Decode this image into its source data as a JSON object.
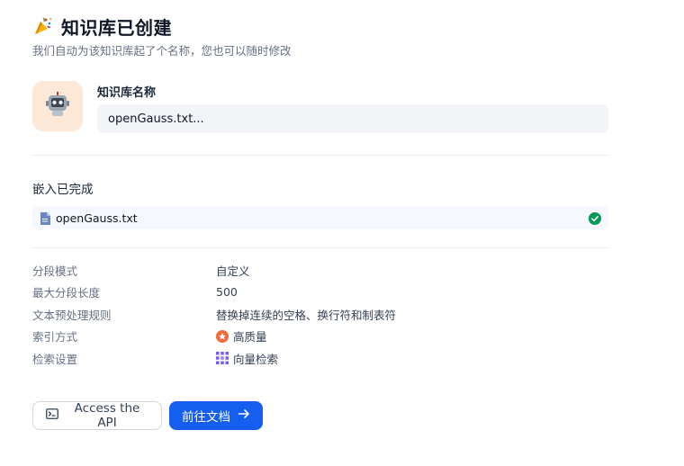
{
  "header": {
    "title": "知识库已创建",
    "subtitle": "我们自动为该知识库起了个名称，您也可以随时修改",
    "icon": "party-popper-icon"
  },
  "name_section": {
    "label": "知识库名称",
    "value": "openGauss.txt...",
    "avatar_icon": "robot-icon"
  },
  "embed": {
    "title": "嵌入已完成",
    "files": [
      {
        "name": "openGauss.txt",
        "status": "completed"
      }
    ]
  },
  "meta": [
    {
      "key": "分段模式",
      "value": "自定义"
    },
    {
      "key": "最大分段长度",
      "value": "500"
    },
    {
      "key": "文本预处理规则",
      "value": "替换掉连续的空格、换行符和制表符"
    },
    {
      "key": "索引方式",
      "value": "高质量",
      "icon": "high-quality-icon"
    },
    {
      "key": "检索设置",
      "value": "向量检索",
      "icon": "vector-search-icon"
    }
  ],
  "actions": {
    "api_label": "Access the API",
    "go_label": "前往文档"
  },
  "colors": {
    "primary": "#155eef",
    "success": "#039855",
    "avatar_bg": "#fde8d7"
  }
}
